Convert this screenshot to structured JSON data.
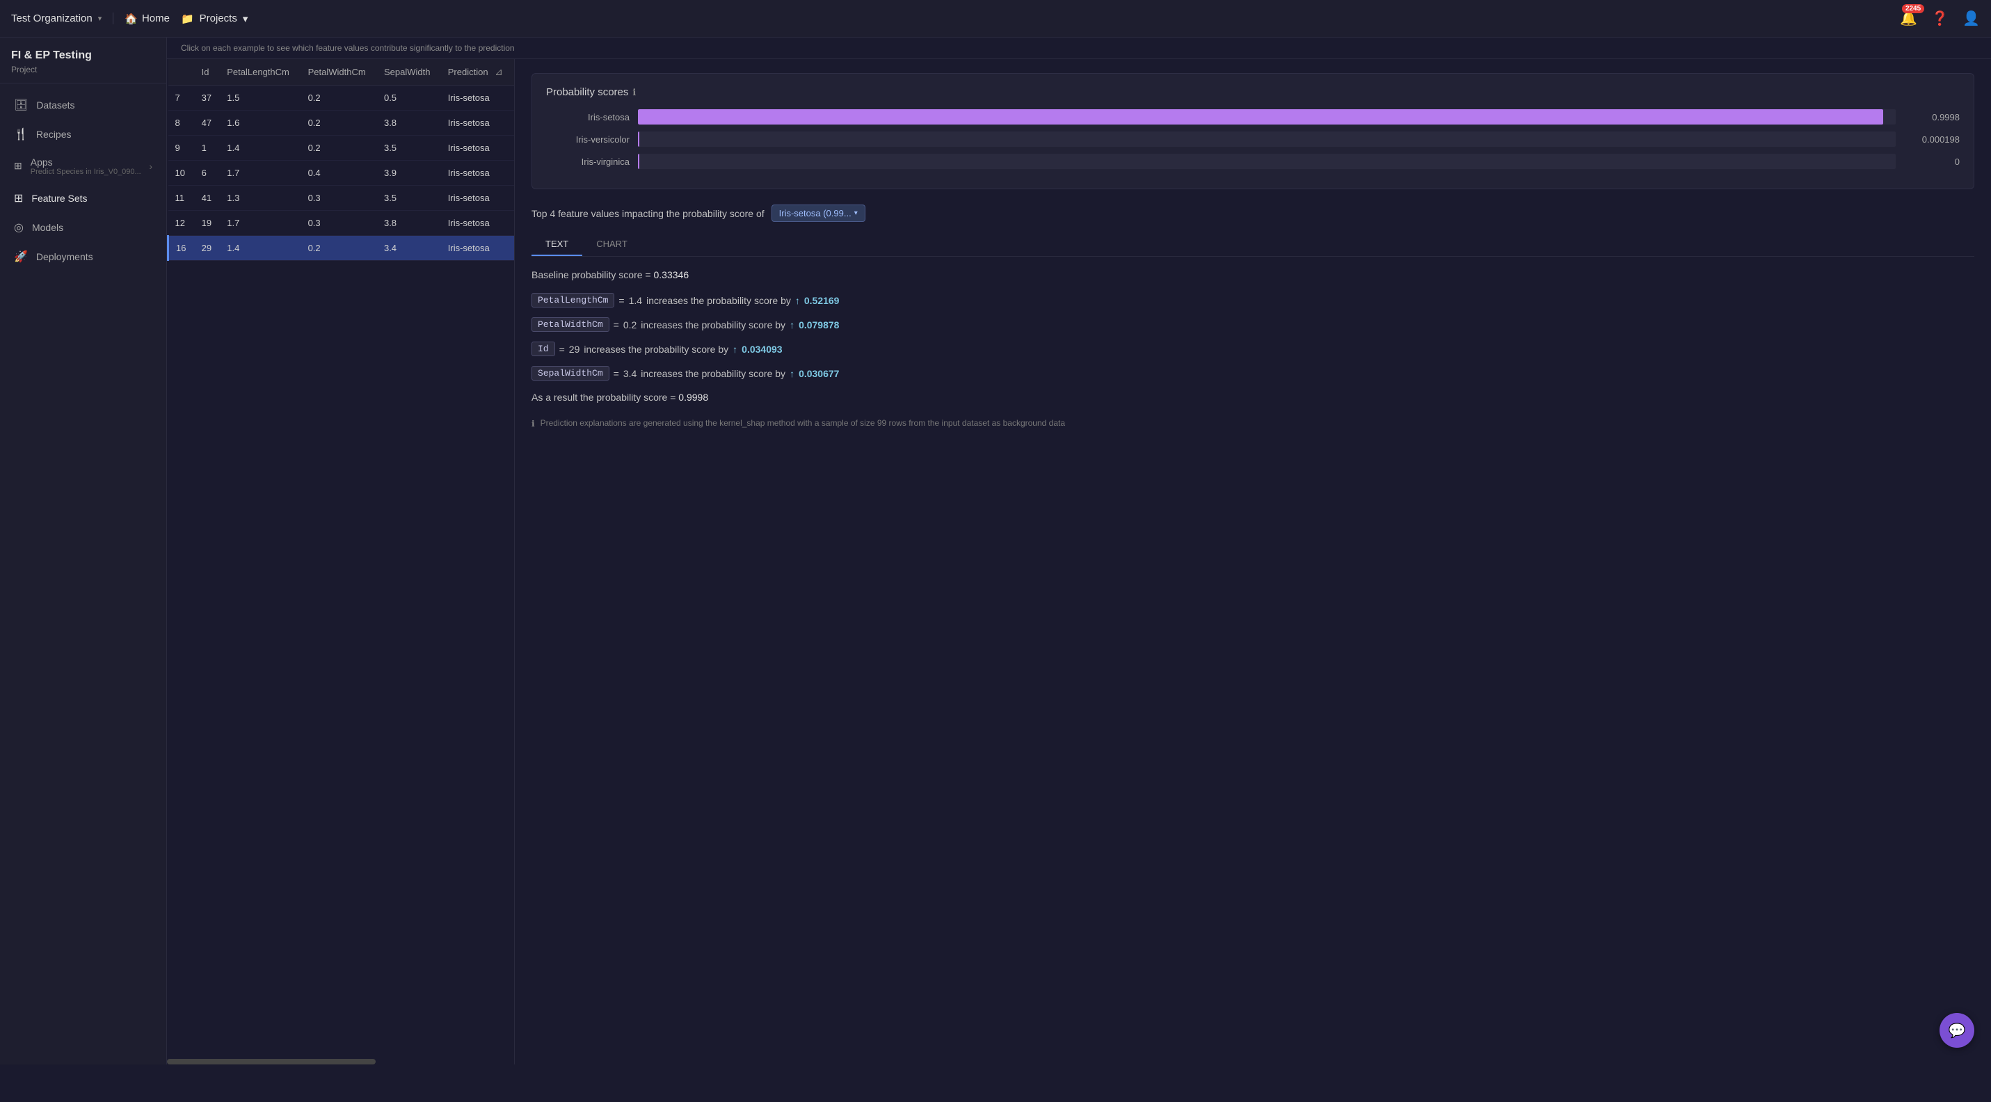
{
  "org": {
    "name": "Test Organization",
    "chevron": "▾"
  },
  "nav": {
    "home_label": "Home",
    "projects_label": "Projects",
    "projects_chevron": "▾"
  },
  "notifications": {
    "count": "2245"
  },
  "sidebar": {
    "project_name": "FI & EP Testing",
    "project_sub": "Project",
    "items": [
      {
        "id": "datasets",
        "label": "Datasets",
        "icon": "🗄"
      },
      {
        "id": "recipes",
        "label": "Recipes",
        "icon": "🍴"
      },
      {
        "id": "apps",
        "label": "Apps",
        "icon": "⊞",
        "sub": "Predict Species in Iris_V0_090...",
        "has_arrow": true
      },
      {
        "id": "feature-sets",
        "label": "Feature Sets",
        "icon": "⊞"
      },
      {
        "id": "models",
        "label": "Models",
        "icon": "◎"
      },
      {
        "id": "deployments",
        "label": "Deployments",
        "icon": "🚀"
      }
    ]
  },
  "subtitle": "Click on each example to see which feature values contribute significantly to the prediction",
  "table": {
    "columns": [
      "Id",
      "PetalLengthCm",
      "PetalWidthCm",
      "SepalWidth",
      "Prediction"
    ],
    "rows": [
      {
        "row_num": "7",
        "id": "37",
        "petal_len": "1.5",
        "petal_wid": "0.2",
        "sepal": "0.5",
        "prediction": "Iris-setosa",
        "selected": false
      },
      {
        "row_num": "8",
        "id": "47",
        "petal_len": "1.6",
        "petal_wid": "0.2",
        "sepal": "3.8",
        "prediction": "Iris-setosa",
        "selected": false
      },
      {
        "row_num": "9",
        "id": "1",
        "petal_len": "1.4",
        "petal_wid": "0.2",
        "sepal": "3.5",
        "prediction": "Iris-setosa",
        "selected": false
      },
      {
        "row_num": "10",
        "id": "6",
        "petal_len": "1.7",
        "petal_wid": "0.4",
        "sepal": "3.9",
        "prediction": "Iris-setosa",
        "selected": false
      },
      {
        "row_num": "11",
        "id": "41",
        "petal_len": "1.3",
        "petal_wid": "0.3",
        "sepal": "3.5",
        "prediction": "Iris-setosa",
        "selected": false
      },
      {
        "row_num": "12",
        "id": "19",
        "petal_len": "1.7",
        "petal_wid": "0.3",
        "sepal": "3.8",
        "prediction": "Iris-setosa",
        "selected": false
      },
      {
        "row_num": "16",
        "id": "29",
        "petal_len": "1.4",
        "petal_wid": "0.2",
        "sepal": "3.4",
        "prediction": "Iris-setosa",
        "selected": true
      }
    ]
  },
  "probability_scores": {
    "title": "Probability scores",
    "scores": [
      {
        "label": "Iris-setosa",
        "value": 0.9998,
        "display": "0.9998",
        "pct": 99
      },
      {
        "label": "Iris-versicolor",
        "value": 0.000198,
        "display": "0.000198",
        "pct": 0.02
      },
      {
        "label": "Iris-virginica",
        "value": 0,
        "display": "0",
        "pct": 0
      }
    ]
  },
  "top4": {
    "title": "Top 4 feature values impacting the probability score of",
    "target": "Iris-setosa (0.99...",
    "tabs": [
      "TEXT",
      "CHART"
    ],
    "active_tab": "TEXT",
    "baseline_label": "Baseline probability score",
    "baseline_eq": "=",
    "baseline_val": "0.33346",
    "features": [
      {
        "chip": "PetalLengthCm",
        "eq": "=",
        "val": "1.4",
        "text": "increases the probability score by",
        "increase": "0.52169"
      },
      {
        "chip": "PetalWidthCm",
        "eq": "=",
        "val": "0.2",
        "text": "increases the probability score by",
        "increase": "0.079878"
      },
      {
        "chip": "Id",
        "eq": "=",
        "val": "29",
        "text": "increases the probability score by",
        "increase": "0.034093"
      },
      {
        "chip": "SepalWidthCm",
        "eq": "=",
        "val": "3.4",
        "text": "increases the probability score by",
        "increase": "0.030677"
      }
    ],
    "result_prefix": "As a result the probability score",
    "result_eq": "=",
    "result_val": "0.9998",
    "footnote": "Prediction explanations are generated using the kernel_shap method with a sample of size 99 rows from the input dataset as background data"
  }
}
